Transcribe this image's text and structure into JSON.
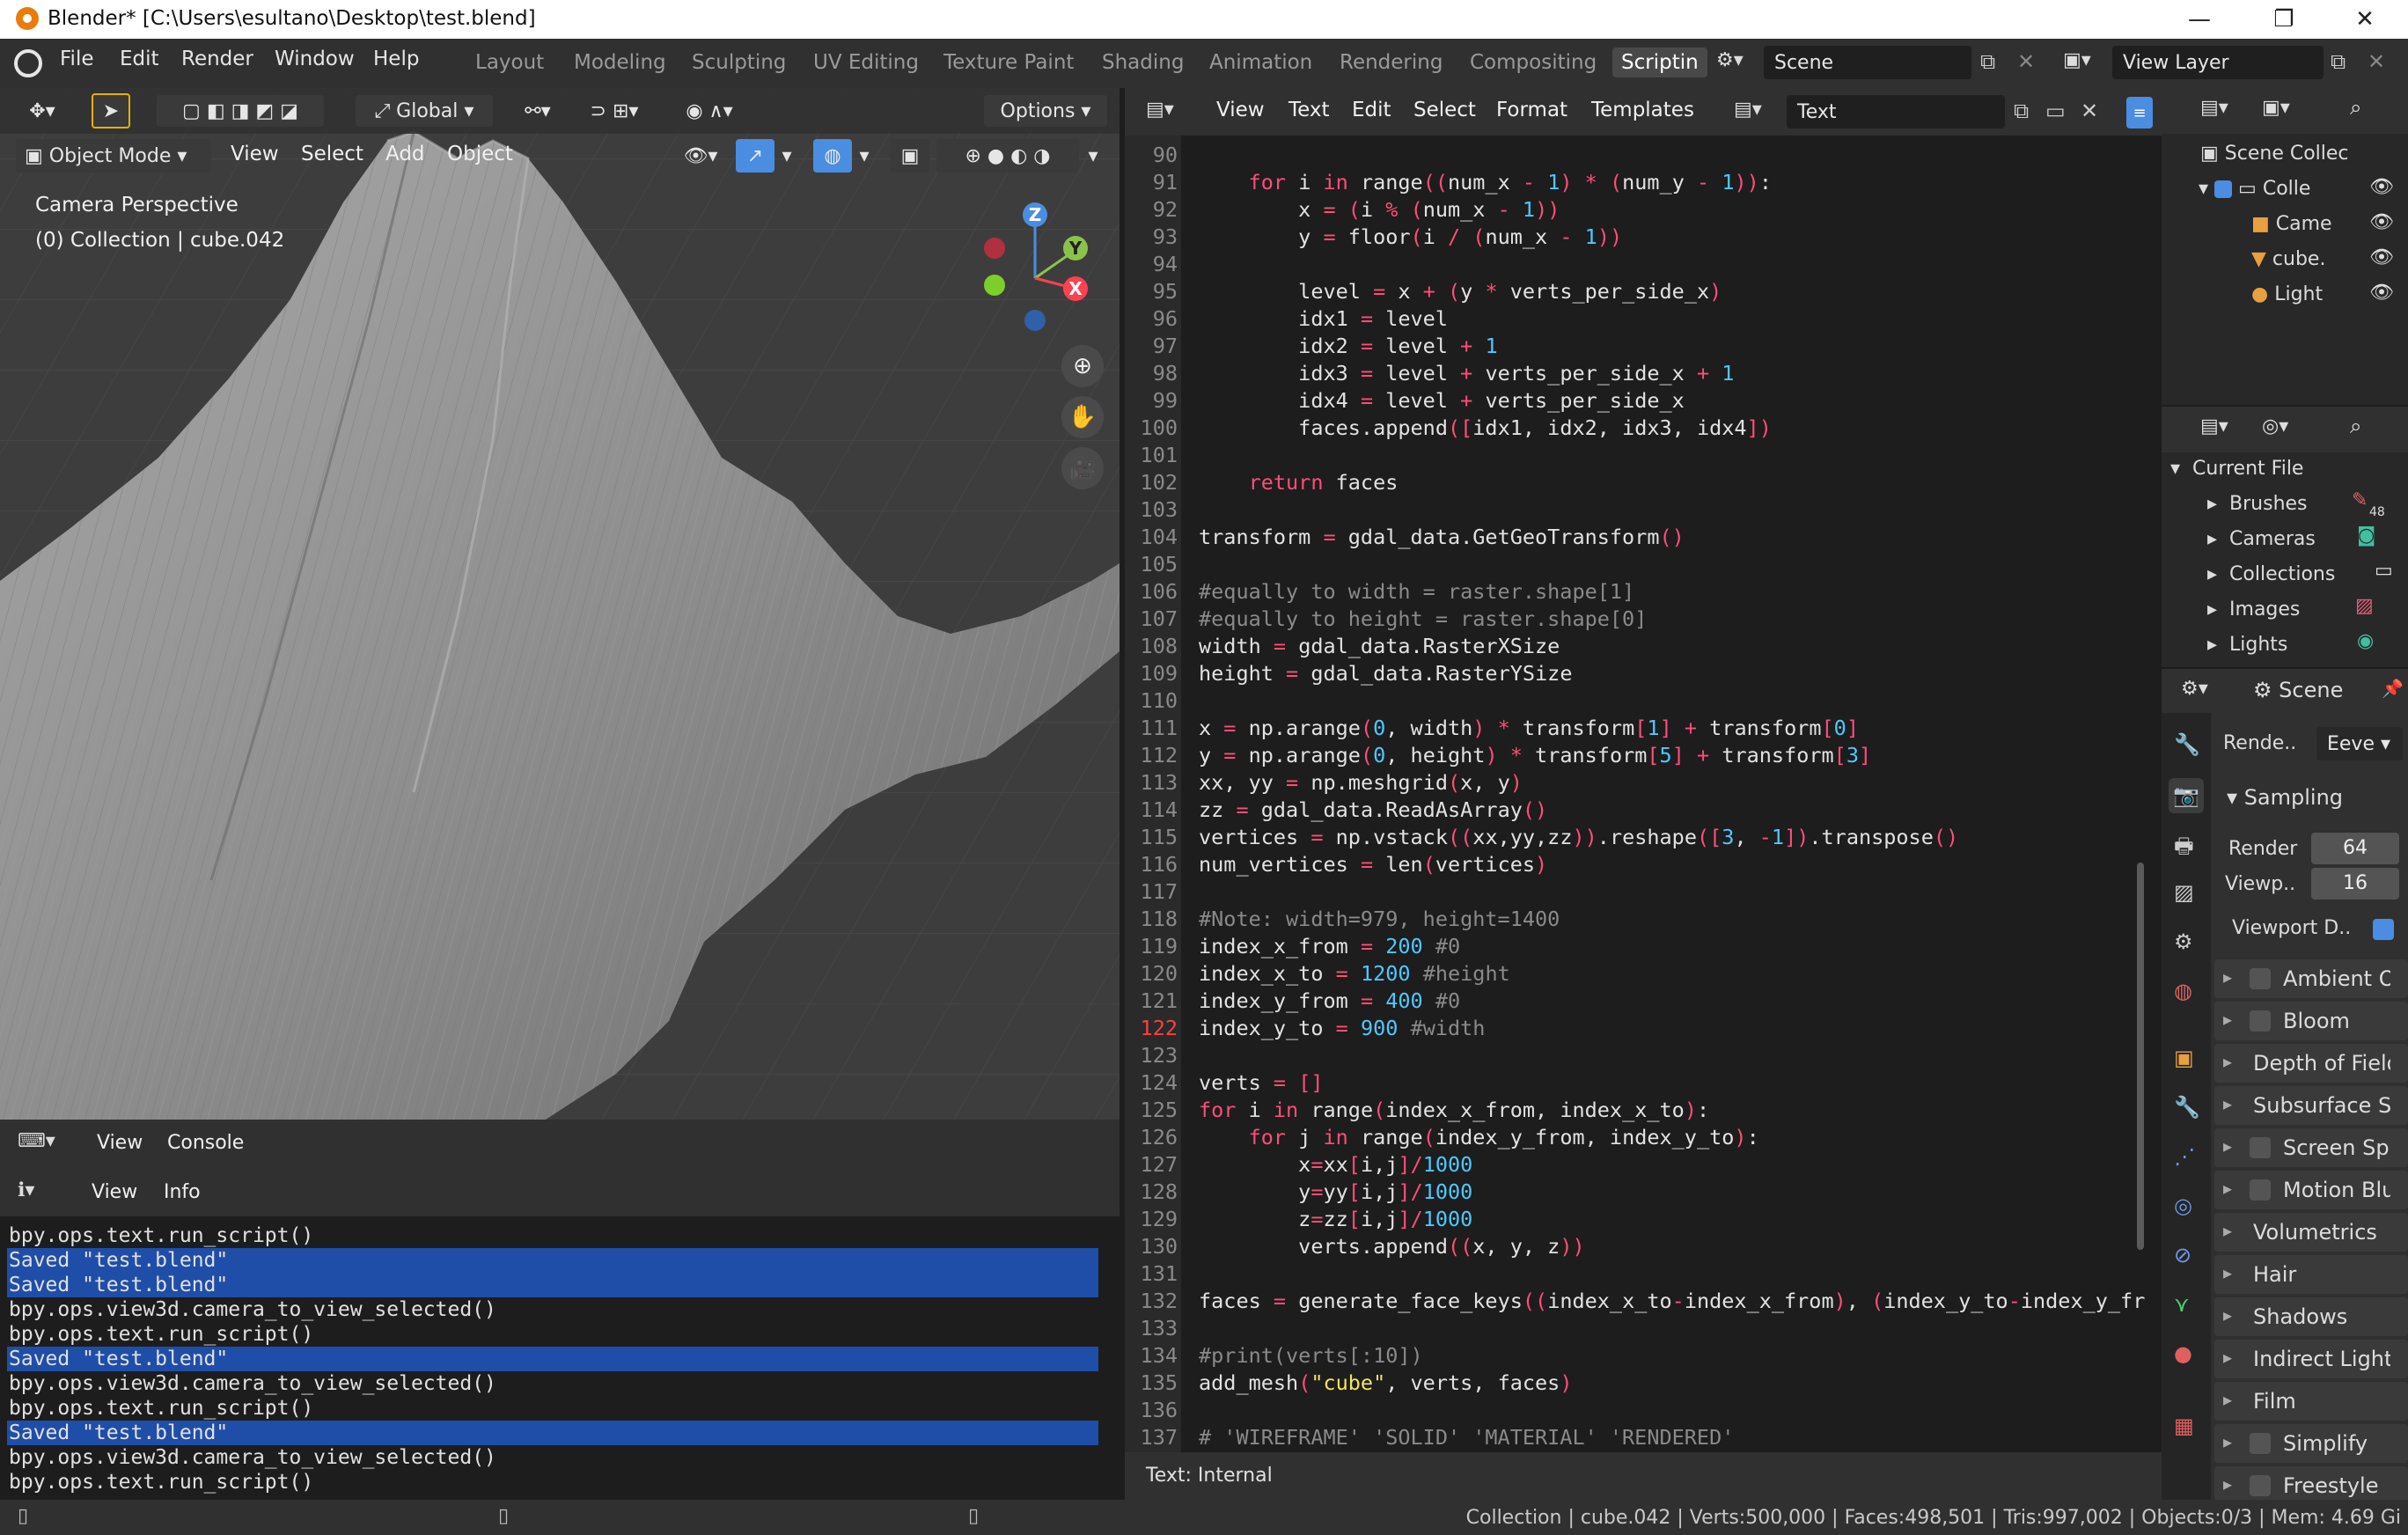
{
  "window": {
    "title": "Blender* [C:\\Users\\esultano\\Desktop\\test.blend]",
    "minimize": "—",
    "restore": "❐",
    "close": "✕"
  },
  "menu": [
    "File",
    "Edit",
    "Render",
    "Window",
    "Help"
  ],
  "workspaces": [
    "Layout",
    "Modeling",
    "Sculpting",
    "UV Editing",
    "Texture Paint",
    "Shading",
    "Animation",
    "Rendering",
    "Compositing",
    "Scriptin"
  ],
  "scene": {
    "name": "Scene",
    "view_layer": "View Layer"
  },
  "viewport": {
    "orientation": "Global",
    "options": "Options",
    "mode": "Object Mode",
    "header_menus": [
      "View",
      "Select",
      "Add",
      "Object"
    ],
    "overlay_title": "Camera Perspective",
    "overlay_sub": "(0) Collection | cube.042",
    "gizmo": {
      "z": "Z",
      "y": "Y",
      "x": "X"
    }
  },
  "console_header": {
    "view": "View",
    "console": "Console"
  },
  "info_header": {
    "view": "View",
    "info": "Info"
  },
  "info_lines": [
    {
      "text": "bpy.ops.text.run_script()",
      "hl": false
    },
    {
      "text": "Saved \"test.blend\"",
      "hl": true
    },
    {
      "text": "Saved \"test.blend\"",
      "hl": true
    },
    {
      "text": "bpy.ops.view3d.camera_to_view_selected()",
      "hl": false
    },
    {
      "text": "bpy.ops.text.run_script()",
      "hl": false
    },
    {
      "text": "Saved \"test.blend\"",
      "hl": true
    },
    {
      "text": "bpy.ops.view3d.camera_to_view_selected()",
      "hl": false
    },
    {
      "text": "bpy.ops.text.run_script()",
      "hl": false
    },
    {
      "text": "Saved \"test.blend\"",
      "hl": true
    },
    {
      "text": "bpy.ops.view3d.camera_to_view_selected()",
      "hl": false
    },
    {
      "text": "bpy.ops.text.run_script()",
      "hl": false
    }
  ],
  "text_editor": {
    "menus": [
      "View",
      "Text",
      "Edit",
      "Select",
      "Format",
      "Templates"
    ],
    "text_name": "Text",
    "footer": "Text: Internal",
    "current_line": 122,
    "lines": [
      {
        "n": "90",
        "t": ""
      },
      {
        "n": "91",
        "t": "    for i in range((num_x - 1) * (num_y - 1)):"
      },
      {
        "n": "92",
        "t": "        x = (i % (num_x - 1))"
      },
      {
        "n": "93",
        "t": "        y = floor(i / (num_x - 1))"
      },
      {
        "n": "94",
        "t": ""
      },
      {
        "n": "95",
        "t": "        level = x + (y * verts_per_side_x)"
      },
      {
        "n": "96",
        "t": "        idx1 = level"
      },
      {
        "n": "97",
        "t": "        idx2 = level + 1"
      },
      {
        "n": "98",
        "t": "        idx3 = level + verts_per_side_x + 1"
      },
      {
        "n": "99",
        "t": "        idx4 = level + verts_per_side_x"
      },
      {
        "n": "100",
        "t": "        faces.append([idx1, idx2, idx3, idx4])"
      },
      {
        "n": "101",
        "t": ""
      },
      {
        "n": "102",
        "t": "    return faces"
      },
      {
        "n": "103",
        "t": ""
      },
      {
        "n": "104",
        "t": "transform = gdal_data.GetGeoTransform()"
      },
      {
        "n": "105",
        "t": ""
      },
      {
        "n": "106",
        "t": "#equally to width = raster.shape[1]"
      },
      {
        "n": "107",
        "t": "#equally to height = raster.shape[0]"
      },
      {
        "n": "108",
        "t": "width = gdal_data.RasterXSize"
      },
      {
        "n": "109",
        "t": "height = gdal_data.RasterYSize"
      },
      {
        "n": "110",
        "t": ""
      },
      {
        "n": "111",
        "t": "x = np.arange(0, width) * transform[1] + transform[0]"
      },
      {
        "n": "112",
        "t": "y = np.arange(0, height) * transform[5] + transform[3]"
      },
      {
        "n": "113",
        "t": "xx, yy = np.meshgrid(x, y)"
      },
      {
        "n": "114",
        "t": "zz = gdal_data.ReadAsArray()"
      },
      {
        "n": "115",
        "t": "vertices = np.vstack((xx,yy,zz)).reshape([3, -1]).transpose()"
      },
      {
        "n": "116",
        "t": "num_vertices = len(vertices)"
      },
      {
        "n": "117",
        "t": ""
      },
      {
        "n": "118",
        "t": "#Note: width=979, height=1400"
      },
      {
        "n": "119",
        "t": "index_x_from = 200 #0"
      },
      {
        "n": "120",
        "t": "index_x_to = 1200 #height"
      },
      {
        "n": "121",
        "t": "index_y_from = 400 #0"
      },
      {
        "n": "122",
        "t": "index_y_to = 900 #width"
      },
      {
        "n": "123",
        "t": ""
      },
      {
        "n": "124",
        "t": "verts = []"
      },
      {
        "n": "125",
        "t": "for i in range(index_x_from, index_x_to):"
      },
      {
        "n": "126",
        "t": "    for j in range(index_y_from, index_y_to):"
      },
      {
        "n": "127",
        "t": "        x=xx[i,j]/1000"
      },
      {
        "n": "128",
        "t": "        y=yy[i,j]/1000"
      },
      {
        "n": "129",
        "t": "        z=zz[i,j]/1000"
      },
      {
        "n": "130",
        "t": "        verts.append((x, y, z))"
      },
      {
        "n": "131",
        "t": ""
      },
      {
        "n": "132",
        "t": "faces = generate_face_keys((index_x_to-index_x_from), (index_y_to-index_y_fr"
      },
      {
        "n": "133",
        "t": ""
      },
      {
        "n": "134",
        "t": "#print(verts[:10])"
      },
      {
        "n": "135",
        "t": "add_mesh(\"cube\", verts, faces)"
      },
      {
        "n": "136",
        "t": ""
      },
      {
        "n": "137",
        "t": "# 'WIREFRAME' 'SOLID' 'MATERIAL' 'RENDERED'"
      }
    ]
  },
  "outliner": {
    "scene_collection": "Scene Collec",
    "items": [
      "Colle",
      "Came",
      "cube.",
      "Light"
    ]
  },
  "file_browser": {
    "root": "Current File",
    "items": [
      "Brushes",
      "Cameras",
      "Collections",
      "Images",
      "Lights"
    ],
    "brush_count": "48"
  },
  "properties": {
    "scene": "Scene",
    "render_engine_label": "Rende..",
    "render_engine": "Eeve",
    "sampling": "Sampling",
    "render_label": "Render",
    "render_value": "64",
    "viewport_label": "Viewp..",
    "viewport_value": "16",
    "viewport_denoise": "Viewport D..",
    "panels": [
      {
        "label": "Ambient Oc",
        "check": true
      },
      {
        "label": "Bloom",
        "check": true
      },
      {
        "label": "Depth of Field",
        "check": false
      },
      {
        "label": "Subsurface Sca",
        "check": false
      },
      {
        "label": "Screen Spa",
        "check": true
      },
      {
        "label": "Motion Blur",
        "check": true
      },
      {
        "label": "Volumetrics",
        "check": false
      },
      {
        "label": "Hair",
        "check": false
      },
      {
        "label": "Shadows",
        "check": false
      },
      {
        "label": "Indirect Lightin",
        "check": false
      },
      {
        "label": "Film",
        "check": false
      },
      {
        "label": "Simplify",
        "check": true
      },
      {
        "label": "Freestyle",
        "check": true
      }
    ]
  },
  "status": "Collection | cube.042 | Verts:500,000 | Faces:498,501 | Tris:997,002 | Objects:0/3 | Mem: 4.69 Gi",
  "colors": {
    "accent": "#4b8de0",
    "info_highlight": "#1f4ea8",
    "keyword": "#ff4d7a",
    "number": "#4fc8ff",
    "string": "#f2e35e"
  }
}
